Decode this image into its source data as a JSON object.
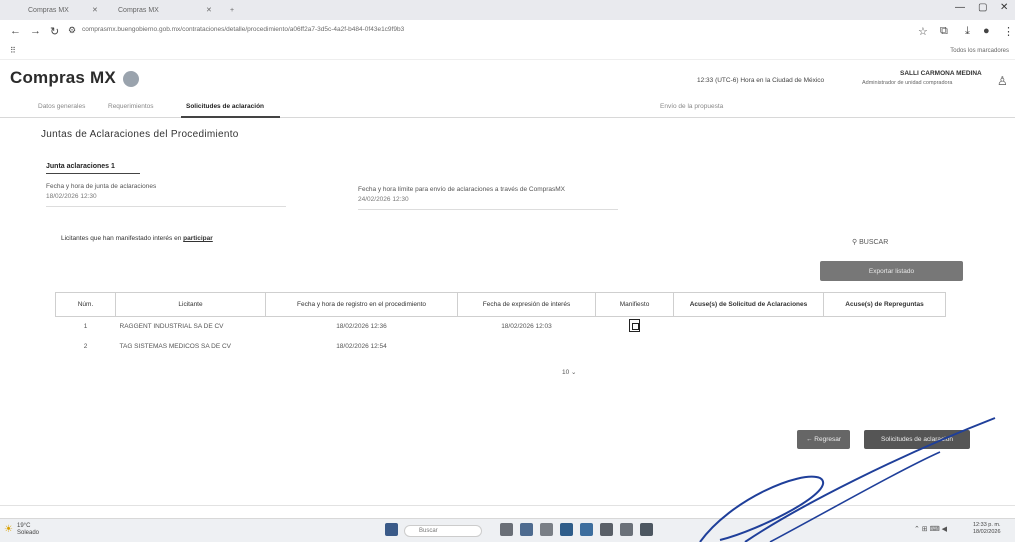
{
  "browser": {
    "tabs": [
      {
        "label": "Compras MX"
      },
      {
        "label": "Compras MX"
      }
    ],
    "url": "comprasmx.buengobierno.gob.mx/contrataciones/detalle/procedimiento/a06ff2a7-3d5c-4a2f-b484-0f43e1c9f9b3",
    "bookmarks_right": "Todos los marcadores"
  },
  "header": {
    "logo": "Compras MX",
    "timezone": "12:33 (UTC-6) Hora en la Ciudad de México",
    "user_name": "SALLI CARMONA MEDINA",
    "user_role": "Administrador de unidad compradora"
  },
  "tabs": [
    {
      "label": "Datos generales"
    },
    {
      "label": "Requerimientos"
    },
    {
      "label": "Solicitudes de aclaración"
    },
    {
      "label": "Envío de la propuesta"
    }
  ],
  "section_title": "Juntas de Aclaraciones del Procedimiento",
  "junta_tab": "Junta aclaraciones 1",
  "fields": {
    "fecha_junta_label": "Fecha y hora de junta de aclaraciones",
    "fecha_junta_value": "18/02/2026 12:30",
    "fecha_limite_label": "Fecha y hora límite para envío de aclaraciones a través de ComprasMX",
    "fecha_limite_value": "24/02/2026 12:30"
  },
  "notice": {
    "text": "Licitantes que han manifestado interés en",
    "bold": "participar"
  },
  "search_label": "BUSCAR",
  "export_label": "Exportar listado",
  "table": {
    "headers": [
      "Núm.",
      "Licitante",
      "Fecha y hora de registro en el procedimiento",
      "Fecha de expresión de interés",
      "Manifiesto",
      "Acuse(s) de Solicitud de Aclaraciones",
      "Acuse(s) de Repreguntas"
    ],
    "rows": [
      {
        "num": "1",
        "licitante": "RAGGENT INDUSTRIAL SA DE CV",
        "registro": "18/02/2026 12:36",
        "interes": "18/02/2026 12:03"
      },
      {
        "num": "2",
        "licitante": "TAG SISTEMAS MEDICOS SA DE CV",
        "registro": "18/02/2026 12:54",
        "interes": ""
      }
    ]
  },
  "pager": "10",
  "buttons": {
    "back": "Regresar",
    "solicitudes": "Solicitudes de aclaración"
  },
  "taskbar": {
    "weather_temp": "19°C",
    "weather_desc": "Soleado",
    "search": "Buscar",
    "time": "12:33 p. m.",
    "date": "18/02/2026"
  }
}
